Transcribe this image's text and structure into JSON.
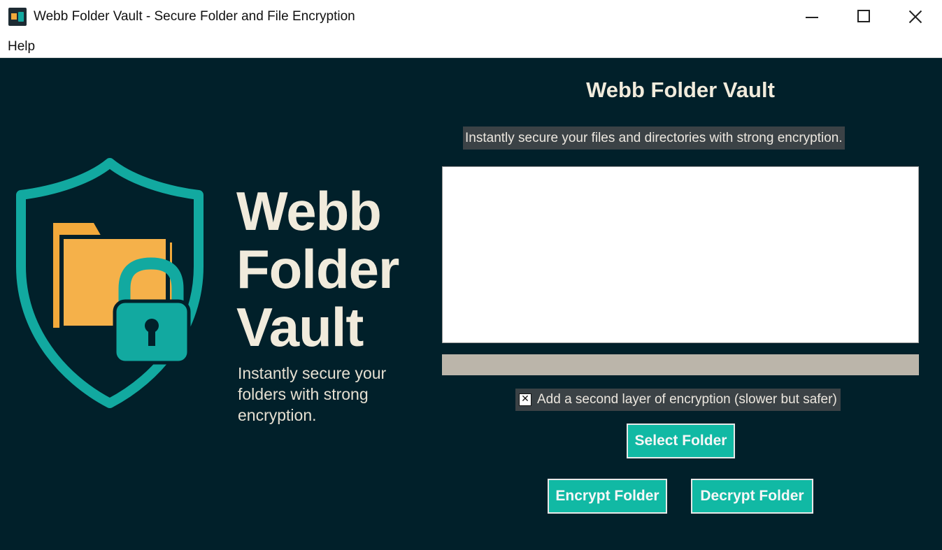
{
  "window": {
    "title": "Webb Folder Vault - Secure Folder and File Encryption",
    "icon": "app-shield-folder-icon"
  },
  "menu": {
    "items": [
      "Help"
    ]
  },
  "brand": {
    "logo": "shield-folder-lock-icon",
    "name": "Webb\nFolder\nVault",
    "tagline": "Instantly secure your folders with strong encryption.",
    "colors": {
      "shield": "#12a9a0",
      "folder": "#f2a93b",
      "text": "#f1ebdc",
      "background": "#01202a"
    }
  },
  "panel": {
    "title": "Webb Folder Vault",
    "subtitle": "Instantly secure your files and directories with strong encryption.",
    "log_text": "",
    "progress": 0,
    "second_layer": {
      "label": "Add a second layer of encryption (slower but safer)",
      "checked": true
    },
    "buttons": {
      "select": "Select Folder",
      "encrypt": "Encrypt Folder",
      "decrypt": "Decrypt Folder"
    },
    "accent": "#11b9a4"
  }
}
